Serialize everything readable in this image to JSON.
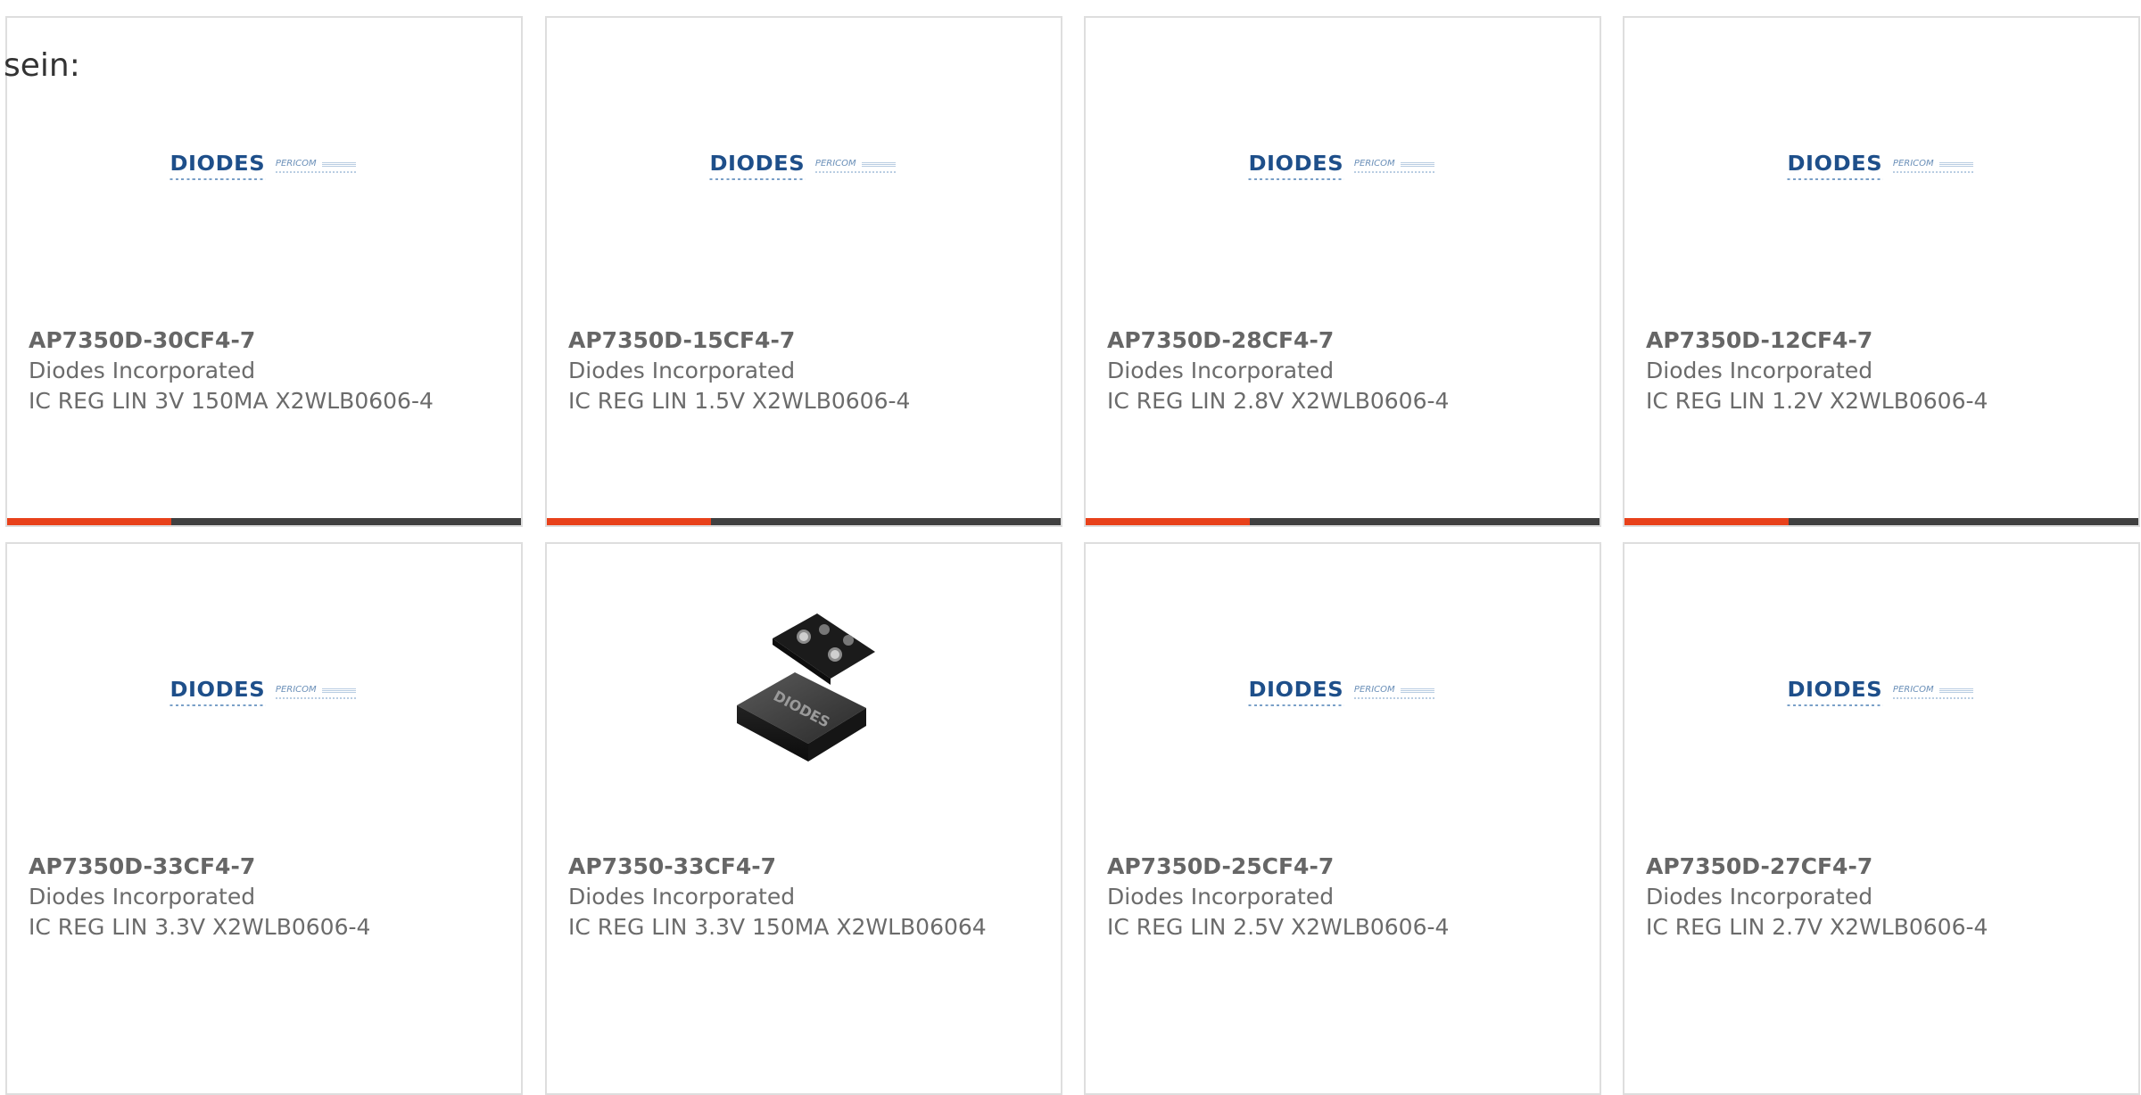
{
  "heading": "sein:",
  "colors": {
    "accent": "#e8411a",
    "bar": "#404040",
    "border": "#dedede",
    "logo_blue": "#1e4f8a"
  },
  "logo": {
    "brand": "DIODES",
    "sub": "PERICOM"
  },
  "products": [
    {
      "part": "AP7350D-30CF4-7",
      "manufacturer": "Diodes Incorporated",
      "description": "IC REG LIN 3V 150MA X2WLB0606-4",
      "image": "diodes-pericom-logo",
      "progress": 0.32
    },
    {
      "part": "AP7350D-15CF4-7",
      "manufacturer": "Diodes Incorporated",
      "description": "IC REG LIN 1.5V X2WLB0606-4",
      "image": "diodes-pericom-logo",
      "progress": 0.32
    },
    {
      "part": "AP7350D-28CF4-7",
      "manufacturer": "Diodes Incorporated",
      "description": "IC REG LIN 2.8V X2WLB0606-4",
      "image": "diodes-pericom-logo",
      "progress": 0.32
    },
    {
      "part": "AP7350D-12CF4-7",
      "manufacturer": "Diodes Incorporated",
      "description": "IC REG LIN 1.2V X2WLB0606-4",
      "image": "diodes-pericom-logo",
      "progress": 0.32
    },
    {
      "part": "AP7350D-33CF4-7",
      "manufacturer": "Diodes Incorporated",
      "description": "IC REG LIN 3.3V X2WLB0606-4",
      "image": "diodes-pericom-logo"
    },
    {
      "part": "AP7350-33CF4-7",
      "manufacturer": "Diodes Incorporated",
      "description": "IC REG LIN 3.3V 150MA X2WLB06064",
      "image": "chip-package-photo"
    },
    {
      "part": "AP7350D-25CF4-7",
      "manufacturer": "Diodes Incorporated",
      "description": "IC REG LIN 2.5V X2WLB0606-4",
      "image": "diodes-pericom-logo"
    },
    {
      "part": "AP7350D-27CF4-7",
      "manufacturer": "Diodes Incorporated",
      "description": "IC REG LIN 2.7V X2WLB0606-4",
      "image": "diodes-pericom-logo"
    }
  ]
}
